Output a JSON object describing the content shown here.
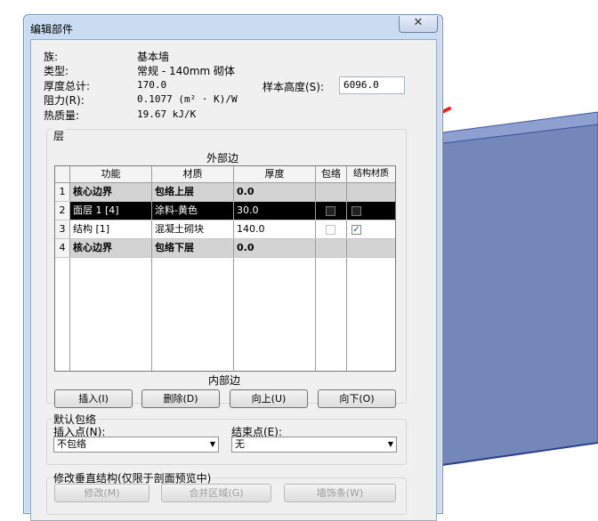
{
  "dialog": {
    "title": "编辑部件",
    "close_glyph": "✕"
  },
  "info": {
    "family_label": "族:",
    "family_value": "基本墙",
    "type_label": "类型:",
    "type_value": "常规 - 140mm 砌体",
    "thickness_label": "厚度总计:",
    "thickness_value": "170.0",
    "resistance_label": "阻力(R):",
    "resistance_value": "0.1077 (m² · K)/W",
    "thermal_label": "热质量:",
    "thermal_value": "19.67 kJ/K",
    "sample_height_label": "样本高度(S):",
    "sample_height_value": "6096.0"
  },
  "layers": {
    "group_title": "层",
    "exterior_label": "外部边",
    "interior_label": "内部边",
    "columns": [
      "功能",
      "材质",
      "厚度",
      "包络",
      "结构材质"
    ],
    "rows": [
      {
        "num": "1",
        "function": "核心边界",
        "material": "包络上层",
        "thickness": "0.0"
      },
      {
        "num": "2",
        "function": "面层 1 [4]",
        "material": "涂料-黄色",
        "thickness": "30.0"
      },
      {
        "num": "3",
        "function": "结构 [1]",
        "material": "混凝土砌块",
        "thickness": "140.0"
      },
      {
        "num": "4",
        "function": "核心边界",
        "material": "包络下层",
        "thickness": "0.0"
      }
    ],
    "row3_structural_check": "✓"
  },
  "buttons": {
    "insert": "插入(I)",
    "delete": "删除(D)",
    "up": "向上(U)",
    "down": "向下(O)"
  },
  "wrapping": {
    "group_title": "默认包络",
    "insert_label": "插入点(N):",
    "insert_value": "不包络",
    "end_label": "结束点(E):",
    "end_value": "无"
  },
  "vertical": {
    "group_title": "修改垂直结构(仅限于剖面预览中)",
    "modify": "修改(M)",
    "merge": "合并区域(G)",
    "sweeps": "墙饰条(W)"
  },
  "colors": {
    "wall_face": "#7388b8",
    "wall_edge": "#3f55a0",
    "arrow": "#e8262a",
    "selected_row": "#000000",
    "core_row": "#d3d3d3"
  }
}
